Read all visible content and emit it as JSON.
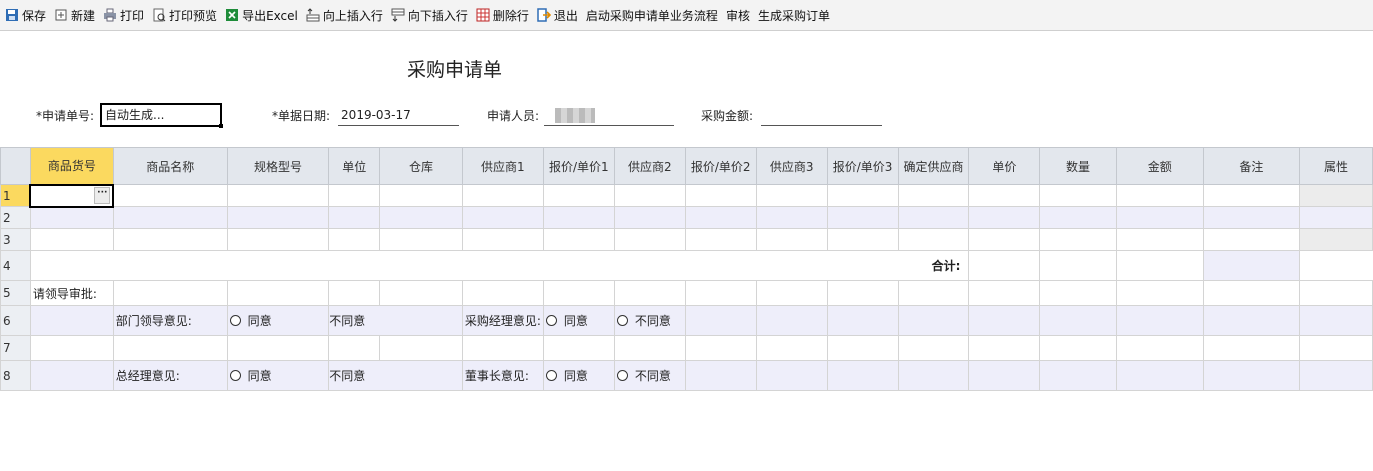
{
  "toolbar": {
    "save": "保存",
    "new": "新建",
    "print": "打印",
    "print_preview": "打印预览",
    "export_excel": "导出Excel",
    "insert_above": "向上插入行",
    "insert_below": "向下插入行",
    "delete_row": "删除行",
    "exit": "退出",
    "start_workflow": "启动采购申请单业务流程",
    "review": "审核",
    "generate_po": "生成采购订单"
  },
  "form": {
    "title": "采购申请单",
    "request_no_label": "*申请单号:",
    "request_no_value": "自动生成...",
    "date_label": "*单据日期:",
    "date_value": "2019-03-17",
    "applicant_label": "申请人员:",
    "amount_label": "采购金额:",
    "amount_value": ""
  },
  "grid": {
    "columns": [
      "商品货号",
      "商品名称",
      "规格型号",
      "单位",
      "仓库",
      "供应商1",
      "报价/单价1",
      "供应商2",
      "报价/单价2",
      "供应商3",
      "报价/单价3",
      "确定供应商",
      "单价",
      "数量",
      "金额",
      "备注",
      "属性"
    ],
    "row_numbers": [
      "1",
      "2",
      "3",
      "4",
      "5",
      "6",
      "7",
      "8"
    ],
    "total_label": "合计:",
    "approval_header": "请领导审批:",
    "dept_leader_label": "部门领导意见:",
    "purchase_manager_label": "采购经理意见:",
    "general_manager_label": "总经理意见:",
    "chairman_label": "董事长意见:",
    "agree": "同意",
    "disagree": "不同意",
    "ellipsis": "···"
  },
  "colors": {
    "header_bg": "#e3e7ed",
    "selected_header": "#fbd95f",
    "alt_row": "#eeeefa"
  }
}
